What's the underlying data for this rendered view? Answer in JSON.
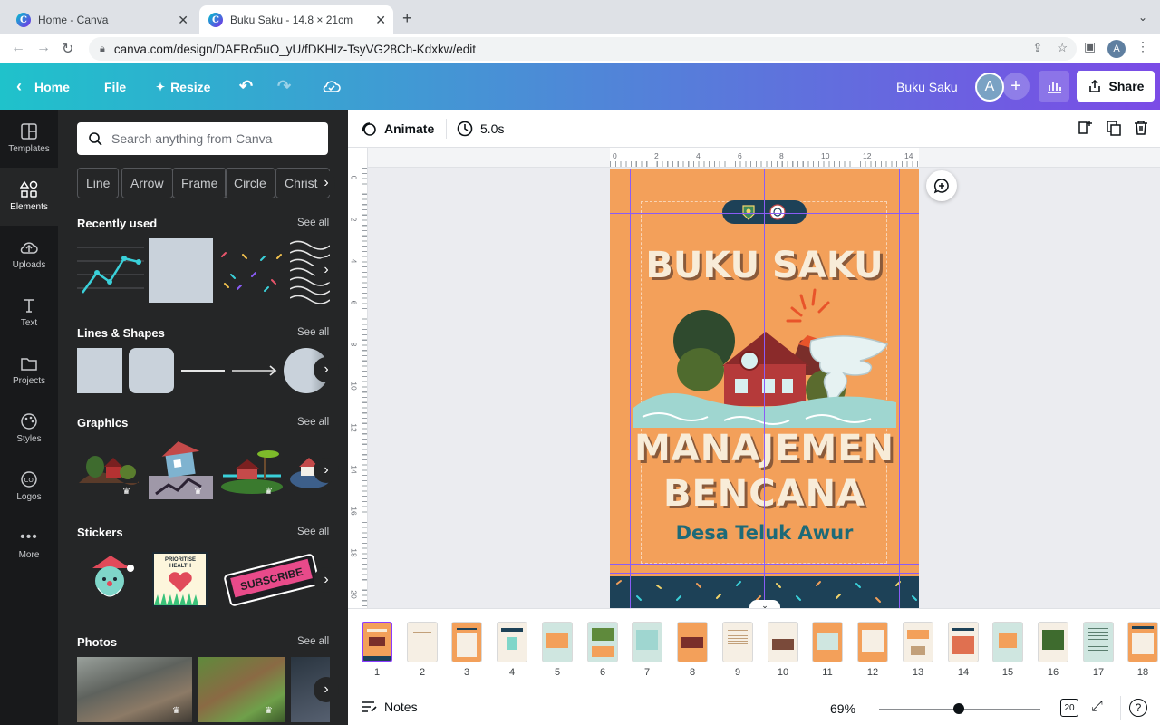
{
  "browser": {
    "tabs": [
      {
        "title": "Home - Canva"
      },
      {
        "title": "Buku Saku - 14.8 × 21cm"
      }
    ],
    "url": "canva.com/design/DAFRo5uO_yU/fDKHIz-TsyVG28Ch-Kdxkw/edit",
    "profile_initial": "A"
  },
  "topbar": {
    "home": "Home",
    "file": "File",
    "resize": "Resize",
    "design_title": "Buku Saku",
    "avatar_initial": "A",
    "share": "Share"
  },
  "rail": [
    {
      "label": "Templates"
    },
    {
      "label": "Elements"
    },
    {
      "label": "Uploads"
    },
    {
      "label": "Text"
    },
    {
      "label": "Projects"
    },
    {
      "label": "Styles"
    },
    {
      "label": "Logos"
    },
    {
      "label": "More"
    }
  ],
  "panel": {
    "search_placeholder": "Search anything from Canva",
    "chips": [
      "Line",
      "Arrow",
      "Frame",
      "Circle",
      "Christmas"
    ],
    "sections": {
      "recent": "Recently used",
      "lines": "Lines & Shapes",
      "graphics": "Graphics",
      "stickers": "Stickers",
      "photos": "Photos"
    },
    "see_all": "See all",
    "sticker_prioritise": "PRIORITISE HEALTH",
    "sticker_subscribe": "SUBSCRIBE"
  },
  "context": {
    "animate": "Animate",
    "duration": "5.0s"
  },
  "ruler": {
    "h": [
      "0",
      "2",
      "4",
      "6",
      "8",
      "10",
      "12",
      "14"
    ],
    "v": [
      "0",
      "2",
      "4",
      "6",
      "8",
      "10",
      "12",
      "14",
      "16",
      "18",
      "20"
    ]
  },
  "design": {
    "title1": "BUKU SAKU",
    "title2": "MANAJEMEN",
    "title3": "BENCANA",
    "subtitle": "Desa Teluk Awur",
    "colors": {
      "bg": "#f3a05a",
      "navy": "#1d4157",
      "teal": "#1d6a78"
    }
  },
  "pages": [
    "1",
    "2",
    "3",
    "4",
    "5",
    "6",
    "7",
    "8",
    "9",
    "10",
    "11",
    "12",
    "13",
    "14",
    "15",
    "16",
    "17",
    "18"
  ],
  "footer": {
    "notes": "Notes",
    "zoom": "69%",
    "page_count": "20"
  }
}
